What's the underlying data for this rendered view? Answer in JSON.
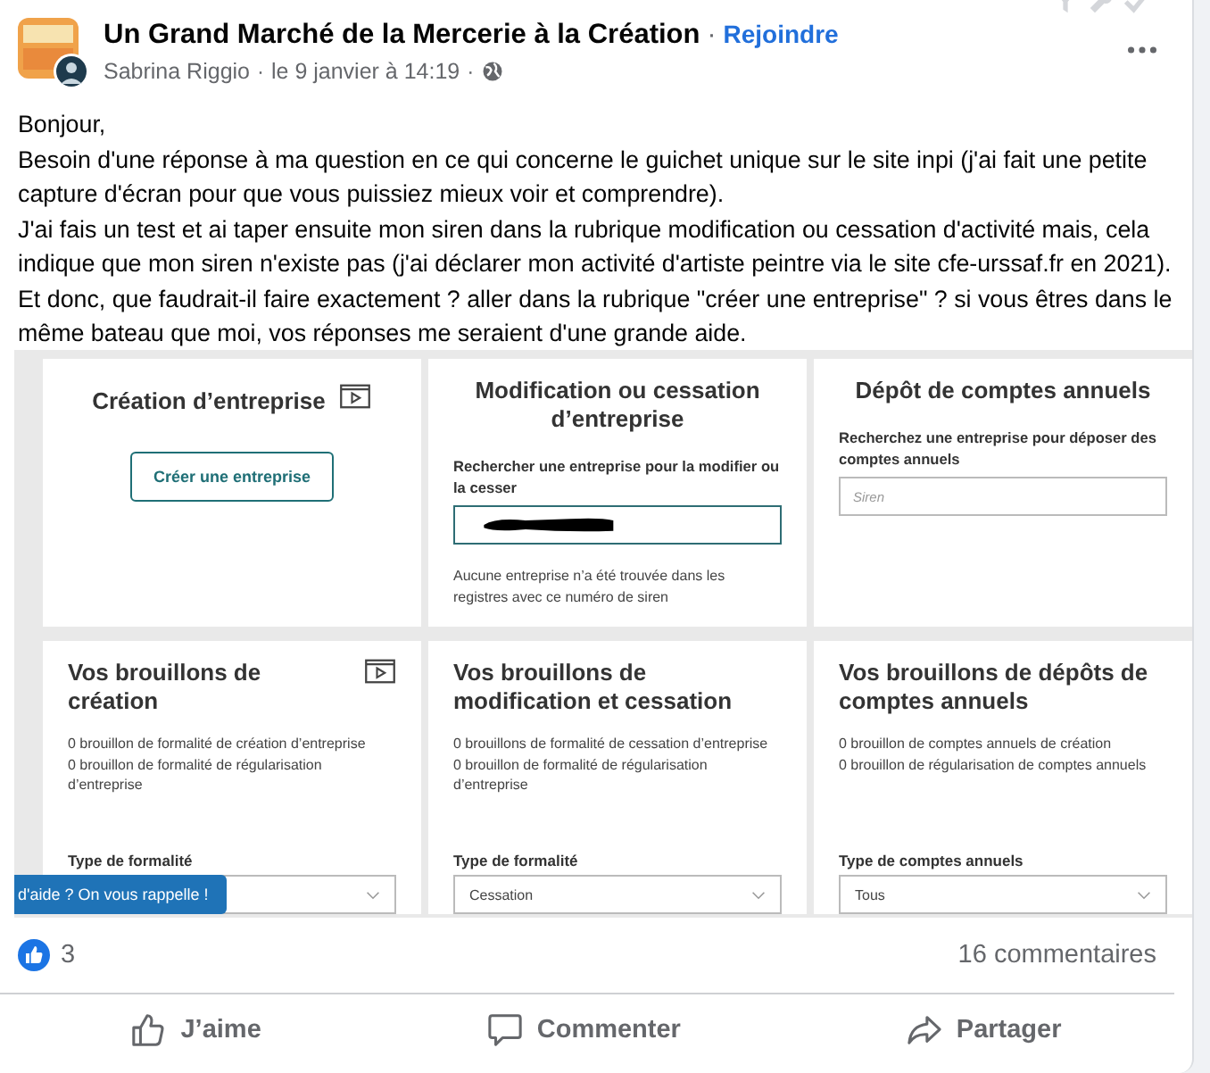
{
  "post": {
    "group_name": "Un Grand Marché de la Mercerie à la Création",
    "separator": "·",
    "join_link": "Rejoindre",
    "author": "Sabrina Riggio",
    "date": "le 9 janvier à 14:19",
    "paragraphs": [
      "Bonjour,",
      "Besoin d'une réponse à ma question en ce qui concerne le guichet unique sur le site inpi (j'ai fait une petite capture d'écran pour que vous puissiez mieux voir et comprendre).",
      "J'ai fais un test et ai taper ensuite mon siren dans la rubrique modification ou cessation d'activité mais, cela indique que mon siren n'existe pas (j'ai déclarer mon activité d'artiste peintre via le site cfe-urssaf.fr en 2021). Et donc, que faudrait-il faire exactement ? aller dans la rubrique \"créer une entreprise\" ? si vous êtres dans le même bateau que moi, vos réponses me seraient d'une grande aide."
    ]
  },
  "screenshot": {
    "top_cards": [
      {
        "kind": "button",
        "title": "Création d’entreprise",
        "video": true,
        "button": "Créer une entreprise"
      },
      {
        "kind": "search",
        "title": "Modification ou cessation d’entreprise",
        "label": "Rechercher une entreprise pour la modifier ou la cesser",
        "redacted": true,
        "note": "Aucune entreprise n’a été trouvée dans les registres avec ce numéro de siren"
      },
      {
        "kind": "search",
        "title": "Dépôt de comptes annuels",
        "label": "Recherchez une entreprise pour déposer des comptes annuels",
        "placeholder": "Siren"
      }
    ],
    "draft_cards": [
      {
        "title": "Vos brouillons de création",
        "video": true,
        "lines": [
          "0 brouillon de formalité de création d’entreprise",
          "0 brouillon de formalité de régularisation d’entreprise"
        ],
        "select_label": "Type de formalité"
      },
      {
        "title": "Vos brouillons de modification et cessation",
        "video": false,
        "lines": [
          "0 brouillons de formalité de cessation d’entreprise",
          "0 brouillon de formalité de régularisation d’entreprise"
        ],
        "select_label": "Type de formalité",
        "select_value": "Cessation"
      },
      {
        "title": "Vos brouillons de dépôts de comptes annuels",
        "video": false,
        "lines": [
          "0 brouillon de comptes annuels de création",
          "0 brouillon de régularisation de comptes annuels"
        ],
        "select_label": "Type de comptes annuels",
        "select_value": "Tous"
      }
    ],
    "callback_tab": "d'aide ? On vous rappelle !"
  },
  "reactions": {
    "count": "3",
    "comments": "16 commentaires"
  },
  "actions": [
    "J’aime",
    "Commenter",
    "Partager"
  ]
}
